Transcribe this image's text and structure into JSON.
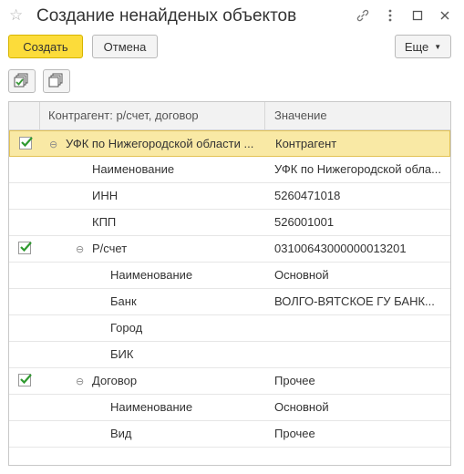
{
  "window": {
    "title": "Создание ненайденых объектов",
    "icons": [
      "star-icon",
      "link-icon",
      "more-vert-icon",
      "maximize-icon",
      "close-icon"
    ]
  },
  "toolbar": {
    "create_label": "Создать",
    "cancel_label": "Отмена",
    "more_label": "Еще"
  },
  "icon_toolbar": [
    "check-all-icon",
    "uncheck-all-icon"
  ],
  "table": {
    "columns": [
      "Контрагент: р/счет, договор",
      "Значение"
    ],
    "rows": [
      {
        "checked": true,
        "toggle": "⊖",
        "label": "УФК по Нижегородской области ...",
        "value": "Контрагент",
        "level": 0
      },
      {
        "label": "Наименование",
        "value": "УФК по Нижегородской обла...",
        "level": 1
      },
      {
        "label": "ИНН",
        "value": "5260471018",
        "level": 1
      },
      {
        "label": "КПП",
        "value": "526001001",
        "level": 1
      },
      {
        "checked": true,
        "toggle": "⊖",
        "label": "Р/счет",
        "value": "03100643000000013201",
        "level": 1
      },
      {
        "label": "Наименование",
        "value": "Основной",
        "level": 2
      },
      {
        "label": "Банк",
        "value": "ВОЛГО-ВЯТСКОЕ ГУ БАНК...",
        "level": 2
      },
      {
        "label": "Город",
        "value": "",
        "level": 2
      },
      {
        "label": "БИК",
        "value": "",
        "level": 2
      },
      {
        "checked": true,
        "toggle": "⊖",
        "label": "Договор",
        "value": "Прочее",
        "level": 1
      },
      {
        "label": "Наименование",
        "value": "Основной",
        "level": 2
      },
      {
        "label": "Вид",
        "value": "Прочее",
        "level": 2
      }
    ]
  }
}
